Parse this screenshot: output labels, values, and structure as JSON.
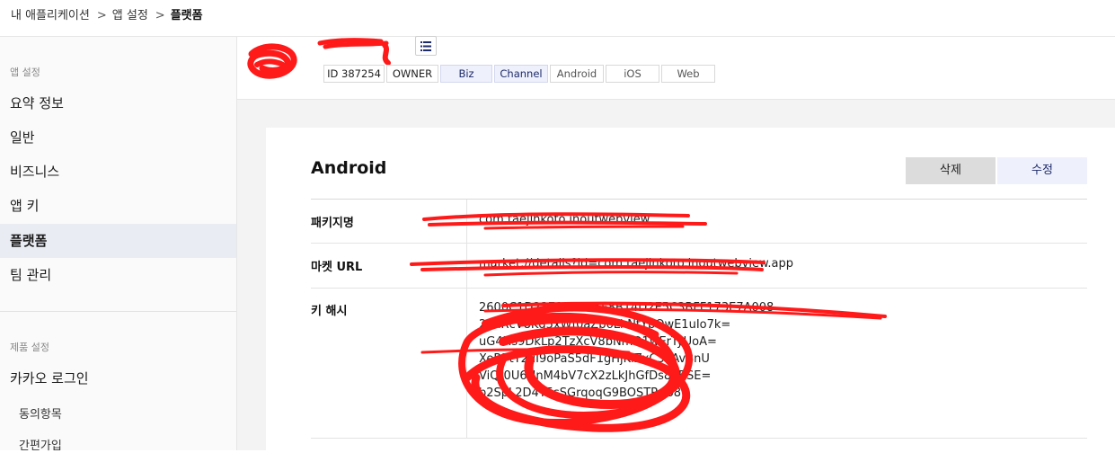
{
  "breadcrumb": {
    "items": [
      "내 애플리케이션",
      "앱 설정"
    ],
    "separator": ">",
    "current": "플랫폼"
  },
  "sidebar": {
    "section1_title": "앱 설정",
    "items": [
      "요약 정보",
      "일반",
      "비즈니스",
      "앱 키",
      "플랫폼",
      "팀 관리"
    ],
    "active_index": 4,
    "section2_title": "제품 설정",
    "product_item": "카카오 로그인",
    "sub_items": [
      "동의항목",
      "간편가입"
    ]
  },
  "app_header": {
    "tags": {
      "id": "ID 387254",
      "owner": "OWNER",
      "biz": "Biz",
      "channel": "Channel",
      "android": "Android",
      "ios": "iOS",
      "web": "Web"
    }
  },
  "platform": {
    "title": "Android",
    "delete_label": "삭제",
    "edit_label": "수정",
    "rows": {
      "package_label": "패키지명",
      "package_value": "com.taejinkoto.inoutwebview",
      "market_label": "마켓 URL",
      "market_value": "market://details?id=com.taejinkoto.inoutwebview.app",
      "hash_label": "키 해시",
      "hash_lines": [
        "2600C1D2371A1BE5F8B14D2E5C3BFF173E7A008",
        "2jmRcV8Kq5xWf0aZb6LhNtYpQwE1uIo7k=",
        "uG4Hs9DkLp2TzXcV8bNmQ1wErTyUoA=",
        "XeR7tY2uI9oPaS5dF1gHjKlZxC3vAvBnU",
        "ViQt0U6NnM4bV7cX2zLkJhGfDs8PRSE=",
        "b2SpL2D4Y5sSGrqoqG9BOSTRp68="
      ]
    }
  },
  "colors": {
    "active_bg": "#e9ecf3",
    "tag_blue_bg": "#eef0fb",
    "delete_bg": "#dcdcdc",
    "scribble": "#ff1a1a"
  }
}
